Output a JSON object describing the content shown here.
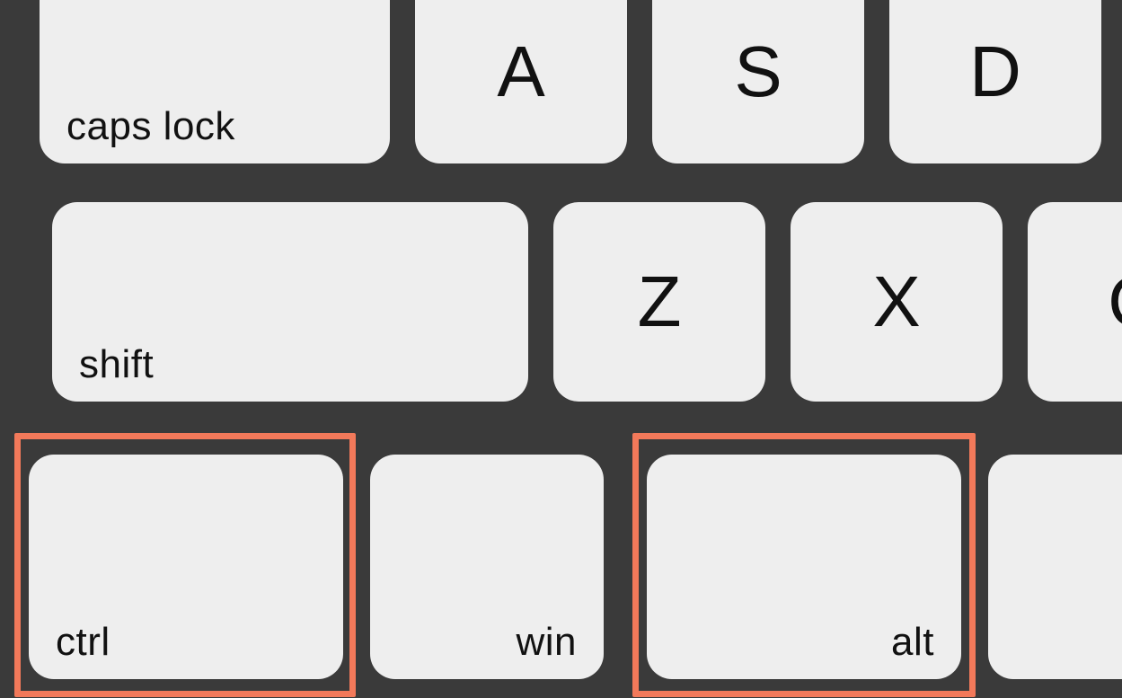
{
  "keys": {
    "caps": "caps lock",
    "a": "A",
    "s": "S",
    "d": "D",
    "shift": "shift",
    "z": "Z",
    "x": "X",
    "c": "C",
    "ctrl": "ctrl",
    "win": "win",
    "alt": "alt"
  },
  "highlighted": [
    "ctrl",
    "alt"
  ],
  "colors": {
    "background": "#3a3a3a",
    "key": "#eeeeee",
    "highlight": "#f2795a"
  }
}
